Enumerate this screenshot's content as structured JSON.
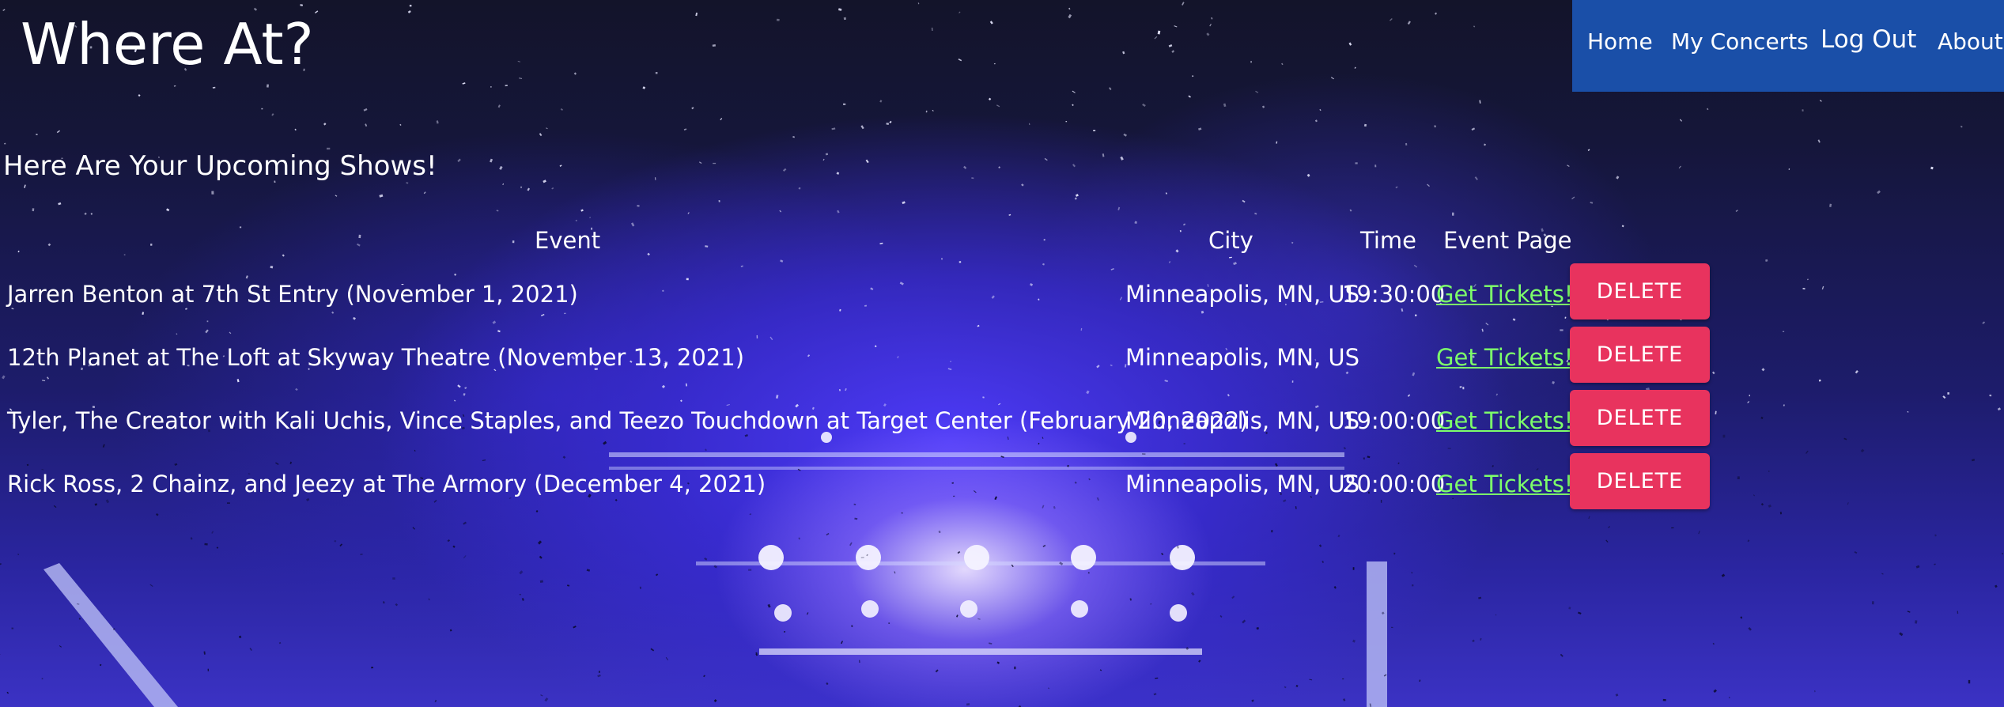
{
  "header": {
    "title": "Where At?"
  },
  "nav": {
    "items": [
      "Home",
      "My Concerts",
      "Log Out",
      "About"
    ],
    "bg_color": "#1a4fa8"
  },
  "page": {
    "heading": "Here Are Your Upcoming Shows!"
  },
  "table": {
    "headers": [
      "Event",
      "City",
      "Time",
      "Event Page"
    ],
    "rows": [
      {
        "event": "Jarren Benton at 7th St Entry (November 1, 2021)",
        "city": "Minneapolis, MN, US",
        "time": "19:30:00",
        "link": "Get Tickets!",
        "action": "DELETE"
      },
      {
        "event": "12th Planet at The Loft at Skyway Theatre (November 13, 2021)",
        "city": "Minneapolis, MN, US",
        "time": "",
        "link": "Get Tickets!",
        "action": "DELETE"
      },
      {
        "event": "Tyler, The Creator with Kali Uchis, Vince Staples, and Teezo Touchdown at Target Center (February 20, 2022)",
        "city": "Minneapolis, MN, US",
        "time": "19:00:00",
        "link": "Get Tickets!",
        "action": "DELETE"
      },
      {
        "event": "Rick Ross, 2 Chainz, and Jeezy at The Armory (December 4, 2021)",
        "city": "Minneapolis, MN, US",
        "time": "20:00:00",
        "link": "Get Tickets!",
        "action": "DELETE"
      }
    ]
  },
  "colors": {
    "link": "#7dff6a",
    "delete_button": "#e8335e",
    "text": "#ffffff"
  }
}
